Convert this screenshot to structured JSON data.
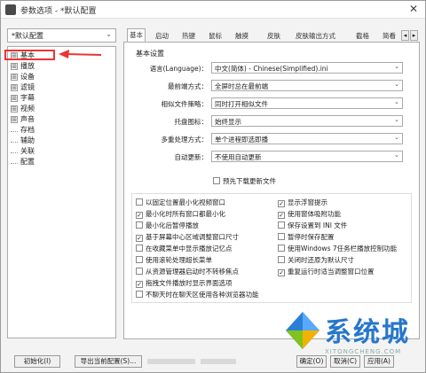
{
  "window": {
    "title": "参数选项 - *默认配置",
    "close_label": "✕"
  },
  "preset": {
    "value": "*默认配置"
  },
  "tree": {
    "items": [
      {
        "label": "基本",
        "expander": "⊞"
      },
      {
        "label": "播放",
        "expander": "⊞"
      },
      {
        "label": "设备",
        "expander": "⊞"
      },
      {
        "label": "滤镜",
        "expander": "⊞"
      },
      {
        "label": "字幕",
        "expander": "⊞"
      },
      {
        "label": "视频",
        "expander": "⊞"
      },
      {
        "label": "声音",
        "expander": "⊞"
      },
      {
        "label": "存档",
        "expander": ""
      },
      {
        "label": "辅助",
        "expander": ""
      },
      {
        "label": "关联",
        "expander": ""
      },
      {
        "label": "配置",
        "expander": ""
      }
    ]
  },
  "tabs": [
    "基本",
    "启动",
    "热键",
    "鼠标",
    "触摸",
    "皮肤",
    "皮肤输出方式",
    "截格",
    "简看"
  ],
  "tab_scroll": {
    "left": "◂",
    "right": "▸"
  },
  "section": {
    "title": "基本设置"
  },
  "settings": [
    {
      "label": "语言(Language)：",
      "value": "中文(简体) - Chinese(Simplified).ini"
    },
    {
      "label": "最前端方式：",
      "value": "全屏时总在最前端"
    },
    {
      "label": "相似文件策略：",
      "value": "同时打开相似文件"
    },
    {
      "label": "托盘图标：",
      "value": "始终显示"
    },
    {
      "label": "多重处理方式：",
      "value": "单个进程即选即播"
    },
    {
      "label": "自动更新：",
      "value": "不使用自动更新"
    }
  ],
  "preview_update": {
    "label": "预先下载更新文件",
    "checked": false
  },
  "checkboxes_left": [
    {
      "label": "以固定位置最小化视频窗口",
      "checked": false
    },
    {
      "label": "最小化时所有窗口都最小化",
      "checked": true
    },
    {
      "label": "最小化后暂停播放",
      "checked": false
    },
    {
      "label": "基于屏幕中心区域调整窗口尺寸",
      "checked": true
    },
    {
      "label": "在收藏菜单中显示播放记忆点",
      "checked": false
    },
    {
      "label": "使用滚轮处理超长菜单",
      "checked": false
    },
    {
      "label": "从资源管理器启动时不转移焦点",
      "checked": false
    },
    {
      "label": "拖拽文件播放时显示界面选项",
      "checked": true
    },
    {
      "label": "不聊天时在聊天区使用各种浏览器功能",
      "checked": false
    }
  ],
  "checkboxes_right": [
    {
      "label": "显示浮窗提示",
      "checked": true
    },
    {
      "label": "使用窗体吸附功能",
      "checked": true
    },
    {
      "label": "保存设置到 INI 文件",
      "checked": false
    },
    {
      "label": "暂停时保存配置",
      "checked": false
    },
    {
      "label": "使用Windows 7任务栏播放控制功能",
      "checked": false
    },
    {
      "label": "关闭时还原为默认尺寸",
      "checked": false
    },
    {
      "label": "重复运行时适当调整窗口位置",
      "checked": true
    }
  ],
  "buttons": {
    "init": "初始化(I)",
    "export": "导出当前配置(S)...",
    "ok": "确定(O)",
    "cancel": "取消(C)",
    "apply": "应用(A)"
  },
  "watermark": {
    "text": "系统城",
    "sub": "XITONGCHENG.COM"
  }
}
